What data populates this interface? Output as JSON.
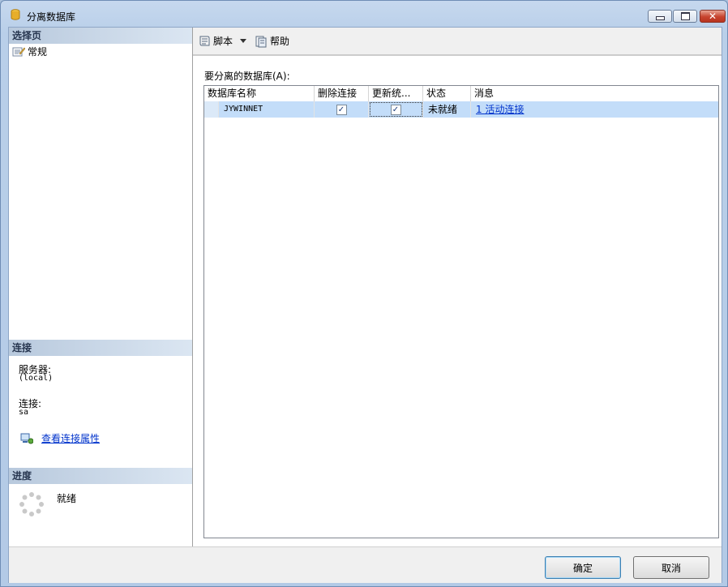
{
  "window": {
    "title": "分离数据库",
    "controls": [
      "minimize",
      "maximize",
      "close"
    ]
  },
  "left_pane": {
    "select_page_header": "选择页",
    "pages": [
      {
        "label": "常规",
        "icon": "general-page-icon"
      }
    ],
    "connection_header": "连接",
    "server_label": "服务器:",
    "server_value": "(local)",
    "connection_label": "连接:",
    "connection_value": "sa",
    "view_connection_properties": "查看连接属性",
    "progress_header": "进度",
    "progress_status": "就绪"
  },
  "toolbar": {
    "script_label": "脚本",
    "help_label": "帮助"
  },
  "main": {
    "grid_label": "要分离的数据库(A):",
    "columns": [
      "数据库名称",
      "删除连接",
      "更新统...",
      "状态",
      "消息"
    ],
    "rows": [
      {
        "database_name": "JYWINNET",
        "drop_connections": true,
        "update_statistics": true,
        "status": "未就绪",
        "message": "1 活动连接"
      }
    ]
  },
  "footer": {
    "ok_label": "确定",
    "cancel_label": "取消"
  },
  "colors": {
    "selected_row": "#c3ddf9",
    "link": "#0033cc",
    "section_header": "#b8c9dd"
  }
}
